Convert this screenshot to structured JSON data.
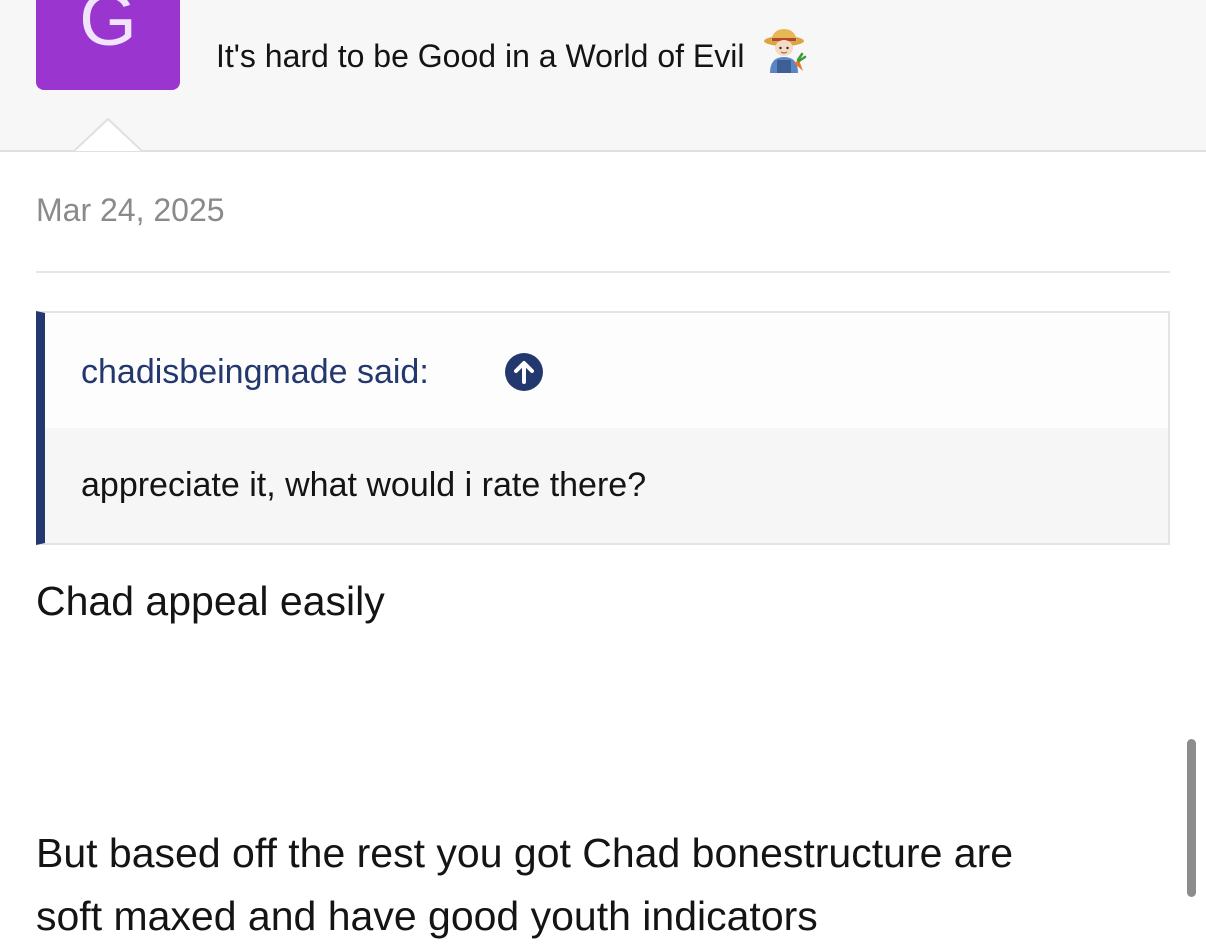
{
  "user": {
    "avatar_letter": "G",
    "username": "",
    "title": "It's hard to be Good in a World of Evil",
    "title_emoji_icon": "farmer-emoji-icon",
    "avatar_color": "#9a35d0"
  },
  "post": {
    "date": "Mar 24, 2025"
  },
  "quote": {
    "author": "chadisbeingmade said:",
    "jump_icon": "arrow-up-circle-icon",
    "text": "appreciate it, what would i rate there?",
    "accent_color": "#23386e"
  },
  "reply": {
    "lines": [
      "Chad appeal easily",
      "But based off the rest you got Chad bonestructure are",
      "soft maxed and have good youth indicators"
    ]
  }
}
